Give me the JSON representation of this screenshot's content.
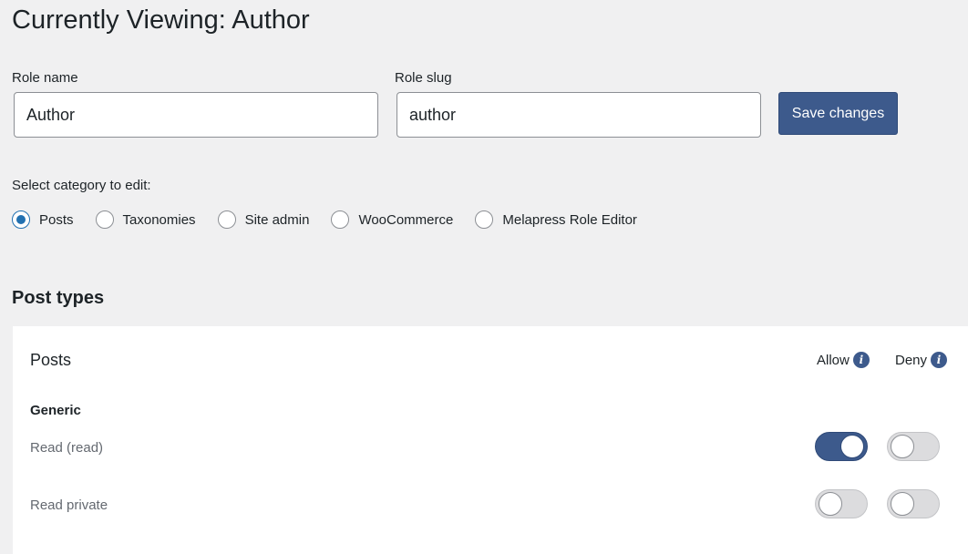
{
  "page": {
    "title": "Currently Viewing: Author"
  },
  "form": {
    "role_name_label": "Role name",
    "role_name_value": "Author",
    "role_slug_label": "Role slug",
    "role_slug_value": "author",
    "save_label": "Save changes"
  },
  "categories": {
    "label": "Select category to edit:",
    "options": [
      {
        "label": "Posts",
        "checked": true
      },
      {
        "label": "Taxonomies",
        "checked": false
      },
      {
        "label": "Site admin",
        "checked": false
      },
      {
        "label": "WooCommerce",
        "checked": false
      },
      {
        "label": "Melapress Role Editor",
        "checked": false
      }
    ]
  },
  "section": {
    "title": "Post types"
  },
  "panel": {
    "title": "Posts",
    "allow_label": "Allow",
    "deny_label": "Deny",
    "group_title": "Generic",
    "capabilities": [
      {
        "label": "Read (read)",
        "allow": true,
        "deny": false
      },
      {
        "label": "Read private",
        "allow": false,
        "deny": false
      }
    ]
  },
  "colors": {
    "accent": "#3d5a8c",
    "radio": "#2271b1",
    "background": "#f0f0f1"
  }
}
